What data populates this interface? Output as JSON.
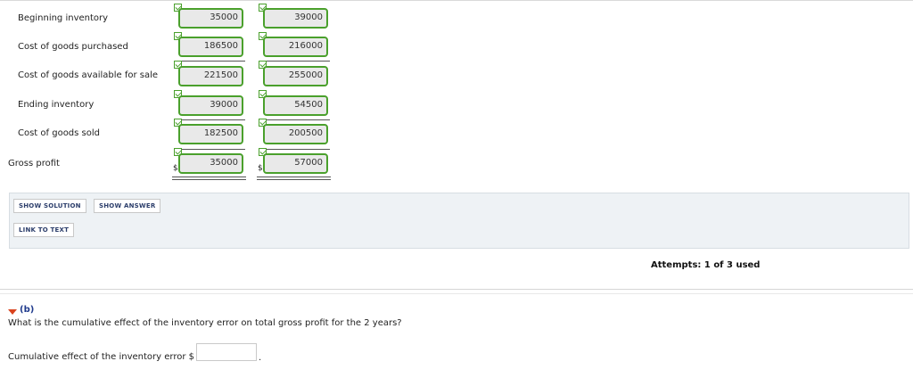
{
  "table": {
    "rows": [
      {
        "label": "Beginning inventory",
        "year1": "35000",
        "year2": "39000"
      },
      {
        "label": "Cost of goods purchased",
        "year1": "186500",
        "year2": "216000"
      },
      {
        "label": "Cost of goods available for sale",
        "year1": "221500",
        "year2": "255000"
      },
      {
        "label": "Ending inventory",
        "year1": "39000",
        "year2": "54500"
      },
      {
        "label": "Cost of goods sold",
        "year1": "182500",
        "year2": "200500"
      },
      {
        "label": "Gross profit",
        "year1": "35000",
        "year2": "57000",
        "currency": "$"
      }
    ]
  },
  "buttons": {
    "show_solution": "SHOW SOLUTION",
    "show_answer": "SHOW ANSWER",
    "link_to_text": "LINK TO TEXT"
  },
  "attempts": "Attempts: 1 of 3 used",
  "part_b": {
    "label": "(b)",
    "question": "What is the cumulative effect of the inventory error on total gross profit for the 2 years?",
    "answer_label": "Cumulative effect of the inventory error $",
    "answer_value": "",
    "suffix": "."
  },
  "colors": {
    "correct_border": "#4aa02c",
    "link_blue": "#1f3a8c",
    "caret_red": "#d9431e"
  }
}
